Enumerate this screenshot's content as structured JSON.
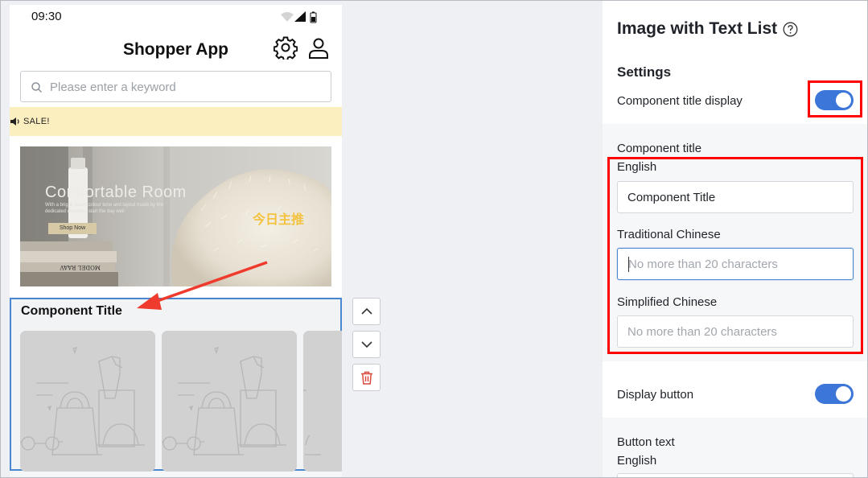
{
  "phone": {
    "status_time": "09:30",
    "app_title": "Shopper App",
    "search": {
      "placeholder": "Please enter a keyword"
    },
    "marquee_text": "SALE!",
    "banner": {
      "headline": "Comfortable Room",
      "subline_1": "With a bright, warm colour tone and layout made by the",
      "subline_2": "dedicated designer, start the day well",
      "button_label": "Shop Now",
      "badge": "今日主推"
    },
    "component": {
      "title": "Component Title"
    }
  },
  "panel": {
    "title": "Image with Text List",
    "settings_heading": "Settings",
    "title_display_label": "Component title display",
    "title_display_on": true,
    "component_title_label": "Component title",
    "english_label": "English",
    "english_value": "Component Title",
    "trad_chinese_label": "Traditional Chinese",
    "trad_chinese_placeholder": "No more than 20 characters",
    "simp_chinese_label": "Simplified Chinese",
    "simp_chinese_placeholder": "No more than 20 characters",
    "display_button_label": "Display button",
    "display_button_on": true,
    "button_text_label": "Button text",
    "button_text_english_label": "English"
  },
  "colors": {
    "accent": "#3b76d8",
    "highlight": "#ff0000",
    "marquee_bg": "#fbeebf",
    "badge": "#f3c23e"
  },
  "icons": [
    "wifi-icon",
    "signal-icon",
    "battery-icon",
    "gear-icon",
    "user-icon",
    "search-icon",
    "speaker-icon",
    "chevron-up-icon",
    "chevron-down-icon",
    "trash-icon",
    "help-icon"
  ]
}
